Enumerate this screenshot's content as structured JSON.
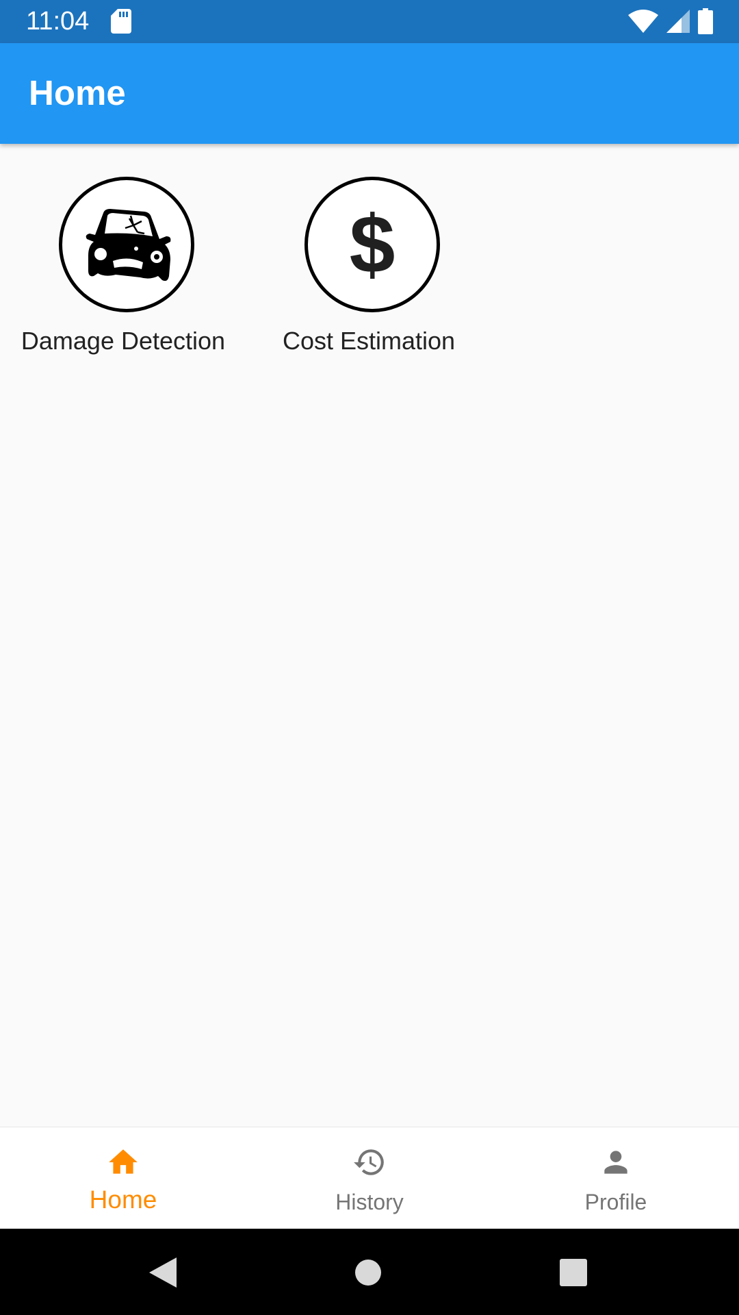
{
  "status_bar": {
    "time": "11:04",
    "icons": [
      "sd-card-icon",
      "wifi-icon",
      "cell-signal-icon",
      "battery-icon"
    ]
  },
  "app_bar": {
    "title": "Home"
  },
  "features": [
    {
      "label": "Damage Detection",
      "icon": "damaged-car-icon"
    },
    {
      "label": "Cost Estimation",
      "icon": "dollar-icon",
      "symbol": "$"
    }
  ],
  "bottom_nav": {
    "items": [
      {
        "label": "Home",
        "icon": "home-icon",
        "selected": true
      },
      {
        "label": "History",
        "icon": "history-icon",
        "selected": false
      },
      {
        "label": "Profile",
        "icon": "person-icon",
        "selected": false
      }
    ]
  },
  "system_nav": {
    "buttons": [
      "back-icon",
      "home-circle-icon",
      "recents-icon"
    ]
  },
  "colors": {
    "status_bar": "#1c73bd",
    "app_bar": "#2196f3",
    "background": "#fafafa",
    "nav_active": "#ff8c00",
    "nav_inactive": "#757575",
    "system_nav": "#000000"
  }
}
